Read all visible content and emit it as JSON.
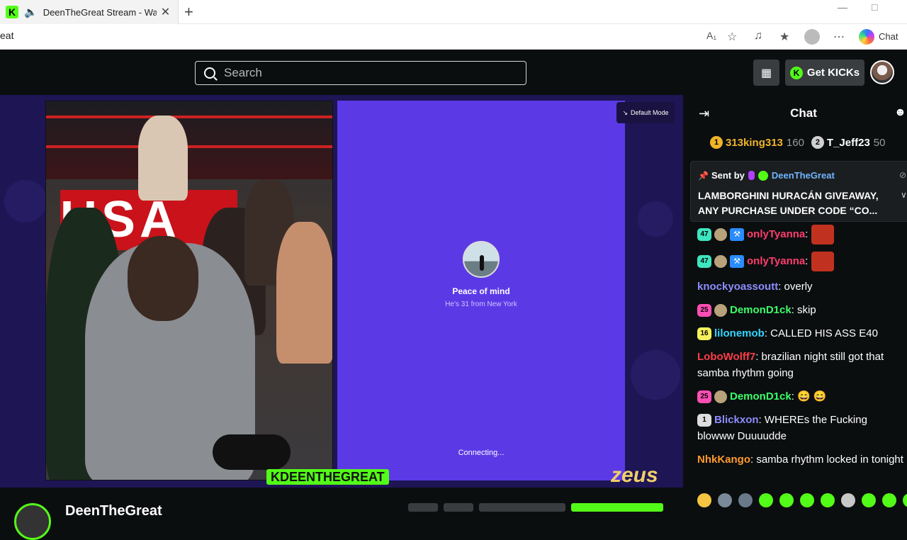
{
  "browser": {
    "tab_title": "DeenTheGreat Stream - Watch",
    "favicon_letter": "K",
    "url_visible": "eat",
    "chat_label": "Chat",
    "icons": [
      "read-aloud-icon",
      "favorite-icon",
      "media-icon",
      "favorites-icon",
      "profile-icon",
      "more-icon",
      "copilot-icon"
    ]
  },
  "site": {
    "search_placeholder": "Search",
    "get_kicks_label": "Get KICKs",
    "kick_letter": "K",
    "accent": "#53fc18"
  },
  "stage": {
    "default_mode_label": "Default Mode",
    "profile_title": "Peace of mind",
    "profile_subtitle": "He's 31 from New York",
    "connecting": "Connecting...",
    "watermark": "KDEENTHEGREAT",
    "sponsor": "zeus",
    "banner_text": "USA",
    "streamer_name": "DeenTheGreat"
  },
  "chat": {
    "title": "Chat",
    "leaderboard": [
      {
        "rank": "1",
        "name": "313king313",
        "count": "160",
        "color": "#f0b429"
      },
      {
        "rank": "2",
        "name": "T_Jeff23",
        "count": "50",
        "color": "#d0d0d0"
      }
    ],
    "pinned": {
      "sent_by_label": "Sent by",
      "sender": "DeenTheGreat",
      "text": "LAMBORGHINI HURACÁN GIVEAWAY, ANY PURCHASE UNDER CODE “CO..."
    },
    "messages": [
      {
        "badge": "47",
        "badge_color": "#3ee6c0",
        "coin": true,
        "mod": true,
        "user": "onlyTyanna",
        "user_color": "#ff3d6e",
        "text": ":",
        "emote": true
      },
      {
        "badge": "47",
        "badge_color": "#3ee6c0",
        "coin": true,
        "mod": true,
        "user": "onlyTyanna",
        "user_color": "#ff3d6e",
        "text": ":",
        "emote": true
      },
      {
        "badge": "",
        "user": "knockyoassoutt",
        "user_color": "#8d8dff",
        "text": ": overly"
      },
      {
        "badge": "25",
        "badge_color": "#ff4fb5",
        "coin": true,
        "user": "DemonD1ck",
        "user_color": "#3cff6a",
        "text": ": skip"
      },
      {
        "badge": "16",
        "badge_color": "#f4f25a",
        "user": "lilonemob",
        "user_color": "#33d6ff",
        "text": ": CALLED HIS ASS E40"
      },
      {
        "badge": "",
        "user": "LoboWolff7",
        "user_color": "#ff3d4a",
        "text": ": brazilian night still got that samba rhythm going"
      },
      {
        "badge": "25",
        "badge_color": "#ff4fb5",
        "coin": true,
        "user": "DemonD1ck",
        "user_color": "#3cff6a",
        "text": ": 😄 😄"
      },
      {
        "badge": "1",
        "badge_color": "#dddddd",
        "user": "Blickxon",
        "user_color": "#8d8dff",
        "text": ": WHEREs the Fucking blowww Duuuudde"
      },
      {
        "badge": "",
        "user": "NhkKango",
        "user_color": "#ff9a2e",
        "text": ": samba rhythm locked in tonight"
      }
    ],
    "emotes": [
      "#f5c542",
      "#7a8a9a",
      "#6b7a8a",
      "#53fc18",
      "#53fc18",
      "#53fc18",
      "#53fc18",
      "#c8c8c8",
      "#53fc18",
      "#53fc18",
      "#53fc18"
    ]
  }
}
